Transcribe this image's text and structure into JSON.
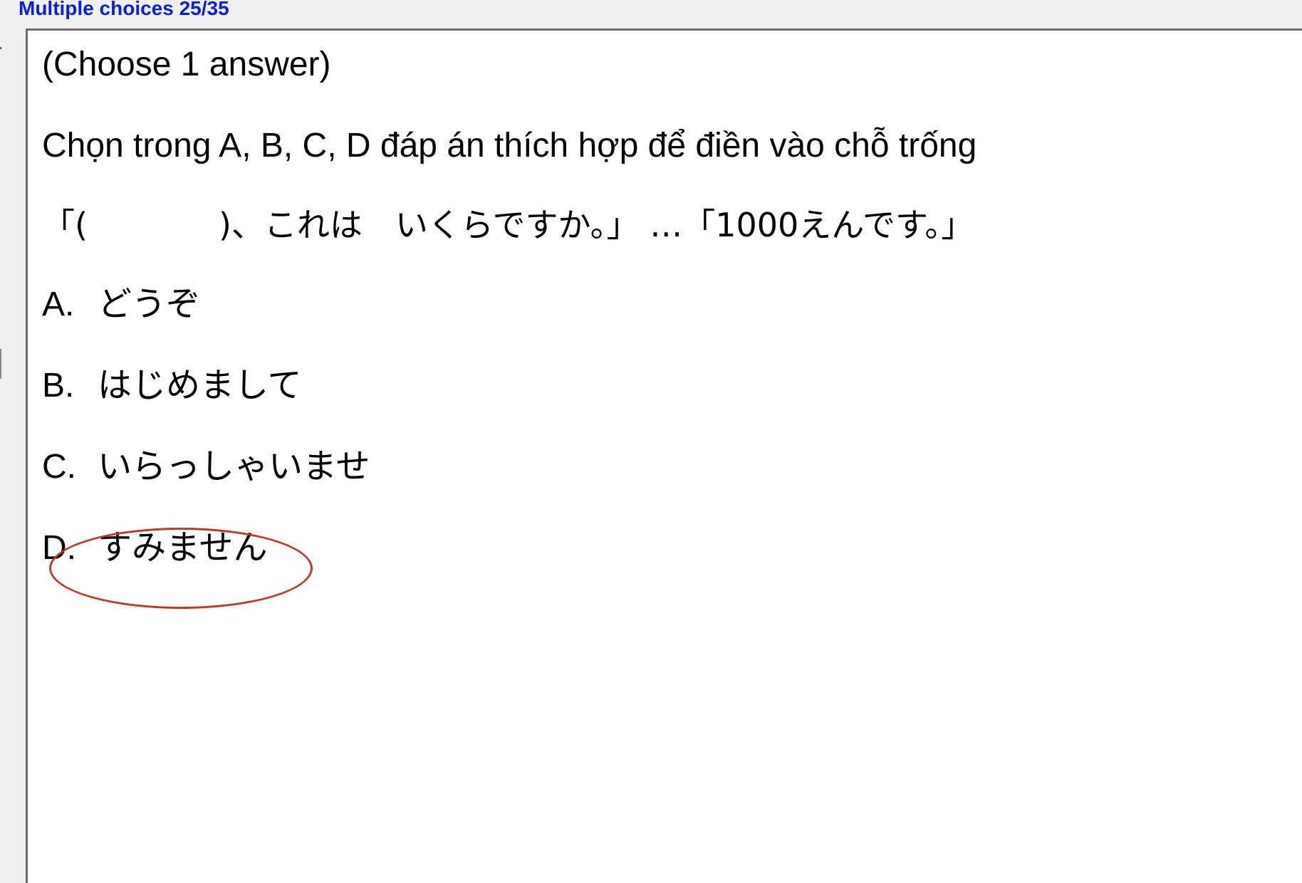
{
  "header": {
    "title": "Multiple choices 25/35"
  },
  "question": {
    "instruction": "(Choose 1 answer)",
    "prompt": "Chọn trong A, B, C, D đáp án thích hợp để điền vào chỗ trống",
    "japanese_text": "「(　　　　)、これは　いくらですか。」 …「1000えんです。」",
    "options": [
      {
        "letter": "A.",
        "text": "どうぞ"
      },
      {
        "letter": "B.",
        "text": "はじめまして"
      },
      {
        "letter": "C.",
        "text": "いらっしゃいませ"
      },
      {
        "letter": "D.",
        "text": "すみません"
      }
    ],
    "marked_answer": "D"
  },
  "colors": {
    "header_text": "#0a1ee6",
    "mark": "#c0392b"
  }
}
